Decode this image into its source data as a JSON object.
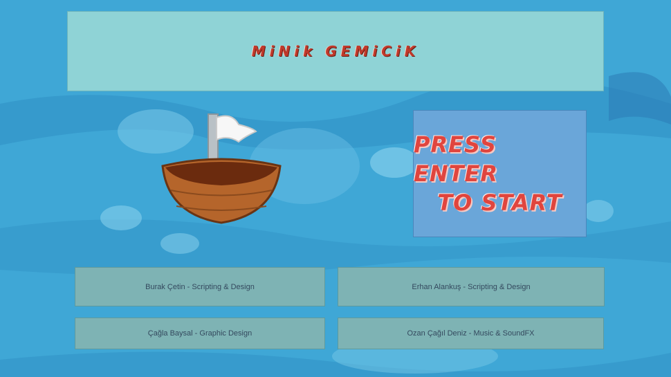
{
  "title": "MiNik GEMiCiK",
  "start_prompt": {
    "line1": "PRESS ENTER",
    "line2": "TO START"
  },
  "credits": [
    "Burak Çetin - Scripting & Design",
    "Erhan Alankuş - Scripting & Design",
    "Çağla Baysal - Graphic Design",
    "Ozan Çağıl Deniz - Music & SoundFX"
  ],
  "colors": {
    "title_panel": "#8fd3d6",
    "start_panel": "#6aa6d9",
    "credit_panel": "#7eb3b4",
    "title_text": "#c0392b",
    "start_text": "#e0453e"
  }
}
